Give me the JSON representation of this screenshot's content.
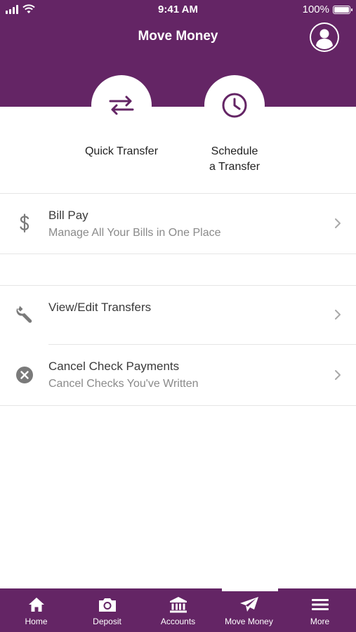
{
  "status_bar": {
    "time": "9:41 AM",
    "battery": "100%",
    "icons": [
      "signal-icon",
      "wifi-icon",
      "battery-icon"
    ]
  },
  "header": {
    "title": "Move Money",
    "avatar_icon": "user-avatar-icon"
  },
  "colors": {
    "brand": "#642565",
    "text": "#333333",
    "subtext": "#8a8a8a",
    "icon_gray": "#7a7a7a"
  },
  "quick_actions": [
    {
      "label": "Quick Transfer",
      "icon": "swap-arrows-icon"
    },
    {
      "label": "Schedule\na Transfer",
      "icon": "clock-icon"
    }
  ],
  "menu": [
    {
      "title": "Bill Pay",
      "subtitle": "Manage All Your Bills in One Place",
      "icon": "dollar-icon"
    },
    {
      "title": "View/Edit Transfers",
      "subtitle": "",
      "icon": "wrench-icon"
    },
    {
      "title": "Cancel Check Payments",
      "subtitle": "Cancel Checks You've Written",
      "icon": "cancel-circle-icon"
    }
  ],
  "tab_bar": {
    "active": "Move Money",
    "tabs": [
      {
        "label": "Home",
        "icon": "home-icon"
      },
      {
        "label": "Deposit",
        "icon": "camera-icon"
      },
      {
        "label": "Accounts",
        "icon": "bank-icon"
      },
      {
        "label": "Move Money",
        "icon": "paper-plane-icon"
      },
      {
        "label": "More",
        "icon": "menu-icon"
      }
    ]
  }
}
